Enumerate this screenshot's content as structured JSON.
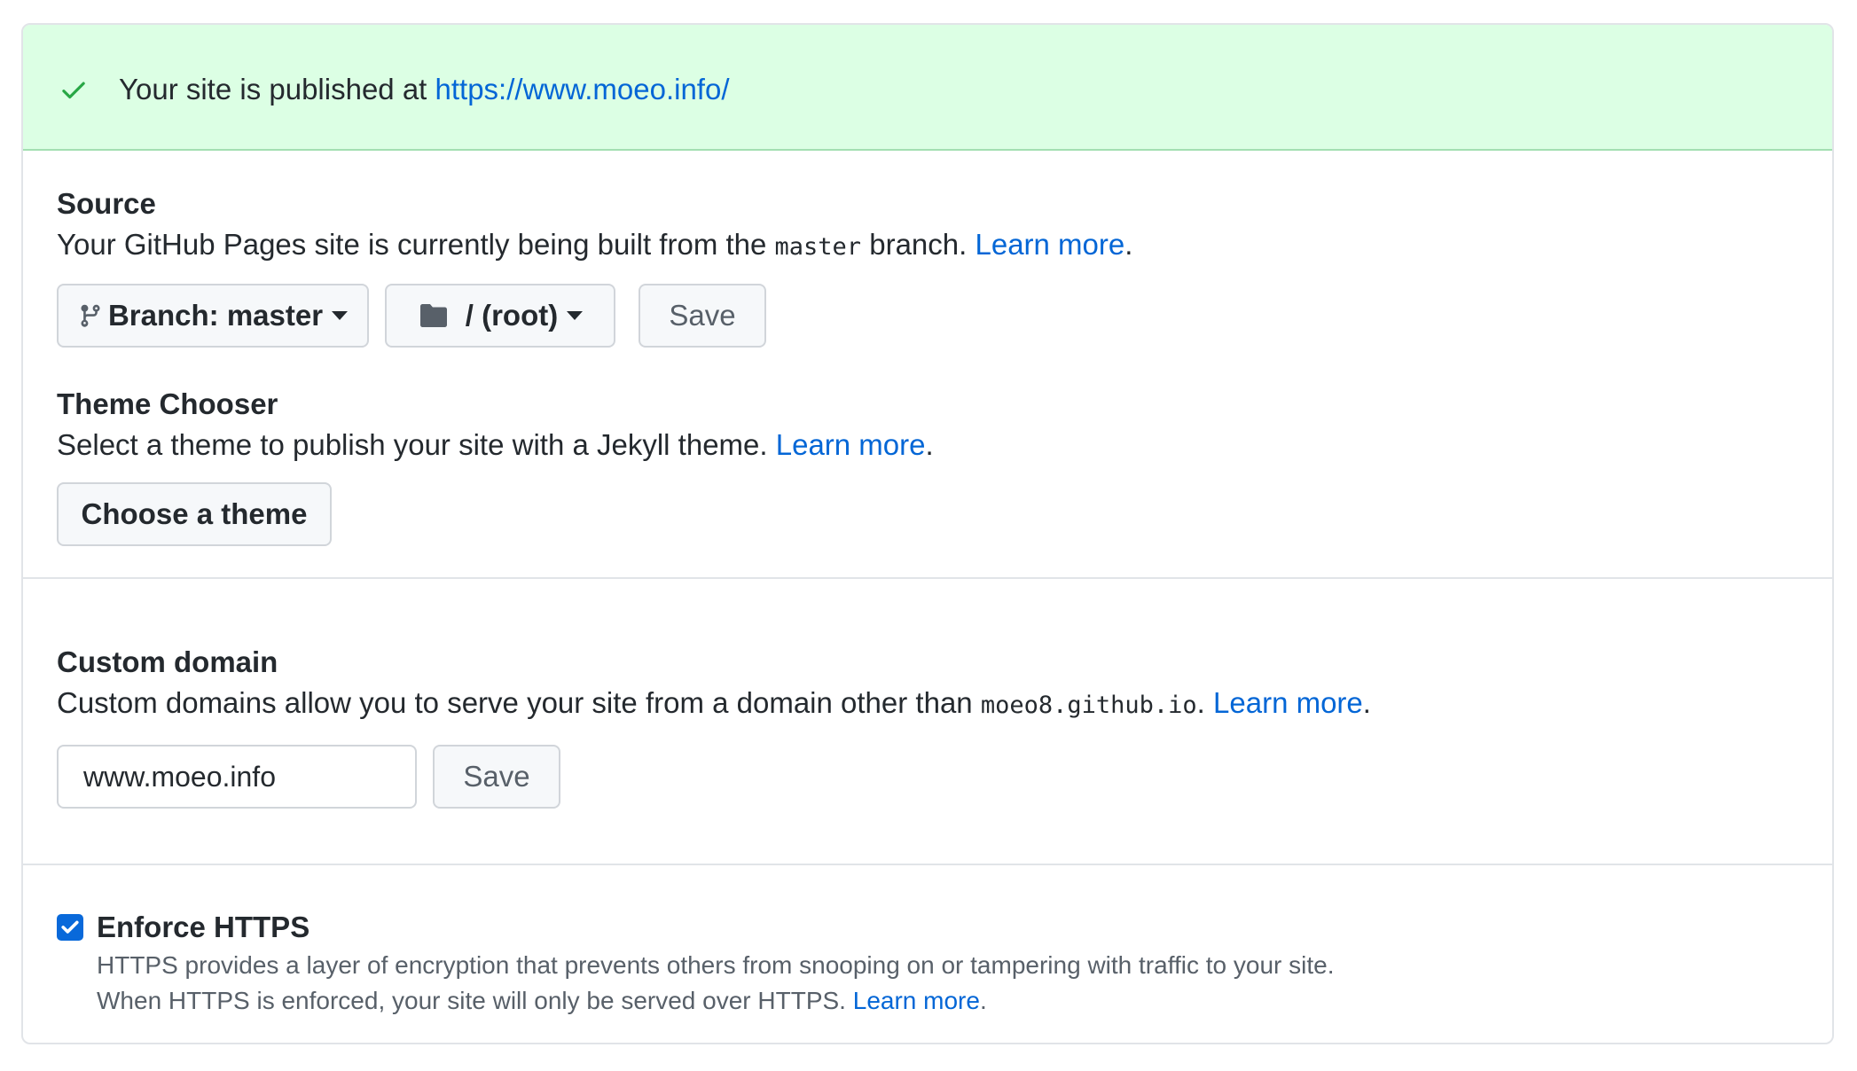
{
  "banner": {
    "text": "Your site is published at ",
    "url": "https://www.moeo.info/"
  },
  "source": {
    "heading": "Source",
    "desc_before": "Your GitHub Pages site is currently being built from the ",
    "branch_code": "master",
    "desc_after": " branch. ",
    "learn_more": "Learn more",
    "period": ".",
    "branch_button": {
      "prefix": "Branch: ",
      "value": "master"
    },
    "folder_button": "/ (root)",
    "save": "Save"
  },
  "theme": {
    "heading": "Theme Chooser",
    "desc": "Select a theme to publish your site with a Jekyll theme. ",
    "learn_more": "Learn more",
    "period": ".",
    "button": "Choose a theme"
  },
  "custom_domain": {
    "heading": "Custom domain",
    "desc_before": "Custom domains allow you to serve your site from a domain other than ",
    "domain_code": "moeo8.github.io",
    "desc_after": ". ",
    "learn_more": "Learn more",
    "period": ".",
    "input_value": "www.moeo.info",
    "save": "Save"
  },
  "https": {
    "label": "Enforce HTTPS",
    "checked": true,
    "line1": "HTTPS provides a layer of encryption that prevents others from snooping on or tampering with traffic to your site.",
    "line2": "When HTTPS is enforced, your site will only be served over HTTPS. ",
    "learn_more": "Learn more",
    "period": "."
  },
  "icons": {
    "banner": "check-icon",
    "branch": "git-branch-icon",
    "folder": "folder-icon",
    "checkbox": "checkmark-icon"
  },
  "colors": {
    "link": "#0366d6",
    "banner_bg": "#dcffe4",
    "check": "#28a745",
    "checkbox": "#0969da"
  }
}
